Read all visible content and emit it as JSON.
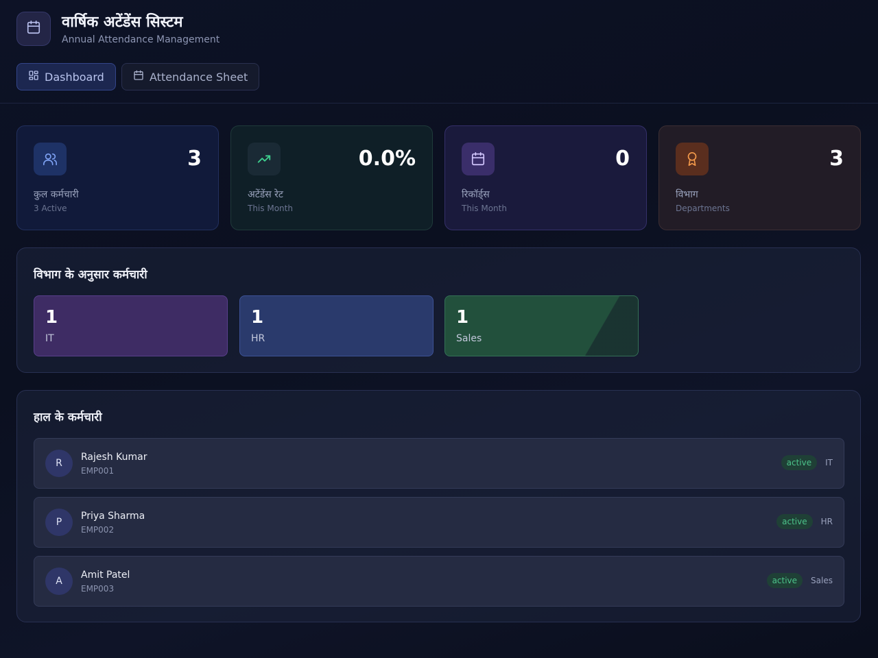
{
  "app": {
    "title": "वार्षिक अटेंडेंस सिस्टम",
    "subtitle": "Annual Attendance Management",
    "logo_icon": "calendar-icon"
  },
  "tabs": [
    {
      "label": "Dashboard",
      "icon": "dashboard-icon",
      "active": true
    },
    {
      "label": "Attendance Sheet",
      "icon": "calendar-icon",
      "active": false
    }
  ],
  "stats": [
    {
      "value": "3",
      "label": "कुल कर्मचारी",
      "sub": "3 Active",
      "icon": "users-icon",
      "color": "#7fa3f5"
    },
    {
      "value": "0.0%",
      "label": "अटेंडेंस रेट",
      "sub": "This Month",
      "icon": "trending-up-icon",
      "color": "#3ecf8e"
    },
    {
      "value": "0",
      "label": "रिकॉर्ड्स",
      "sub": "This Month",
      "icon": "calendar-icon",
      "color": "#c8b6ff"
    },
    {
      "value": "3",
      "label": "विभाग",
      "sub": "Departments",
      "icon": "award-icon",
      "color": "#f59a4b"
    }
  ],
  "departments_panel": {
    "title": "विभाग के अनुसार कर्मचारी",
    "items": [
      {
        "count": "1",
        "name": "IT"
      },
      {
        "count": "1",
        "name": "HR"
      },
      {
        "count": "1",
        "name": "Sales"
      }
    ]
  },
  "employees_panel": {
    "title": "हाल के कर्मचारी",
    "items": [
      {
        "initial": "R",
        "name": "Rajesh Kumar",
        "id": "EMP001",
        "status": "active",
        "dept": "IT"
      },
      {
        "initial": "P",
        "name": "Priya Sharma",
        "id": "EMP002",
        "status": "active",
        "dept": "HR"
      },
      {
        "initial": "A",
        "name": "Amit Patel",
        "id": "EMP003",
        "status": "active",
        "dept": "Sales"
      }
    ]
  }
}
